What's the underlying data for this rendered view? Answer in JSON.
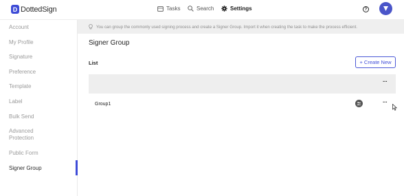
{
  "app": {
    "logo_text": "DottedSign",
    "logo_mark": "D"
  },
  "nav": {
    "tasks": "Tasks",
    "search": "Search",
    "settings": "Settings"
  },
  "header": {
    "help_icon": "question-circle-icon",
    "avatar": "user-avatar"
  },
  "sidebar": {
    "items": [
      {
        "label": "Account"
      },
      {
        "label": "My Profile"
      },
      {
        "label": "Signature"
      },
      {
        "label": "Preference"
      },
      {
        "label": "Template"
      },
      {
        "label": "Label"
      },
      {
        "label": "Bulk Send"
      },
      {
        "label": "Advanced"
      },
      {
        "label": "Protection"
      },
      {
        "label": "Public Form"
      },
      {
        "label": "Signer Group"
      }
    ],
    "active": "Signer Group"
  },
  "banner": {
    "text": "You can group the commonly used signing process and create a Signer Group. Import it when creating the task to make the process efficient."
  },
  "main": {
    "title": "Signer Group",
    "list_label": "List",
    "create_button": "+ Create New",
    "more_label": "···",
    "rows": [
      {
        "name": "Group1"
      }
    ]
  },
  "colors": {
    "accent": "#3f4cd8",
    "banner_bg": "#efefef",
    "header_bg": "#eeeeee"
  }
}
